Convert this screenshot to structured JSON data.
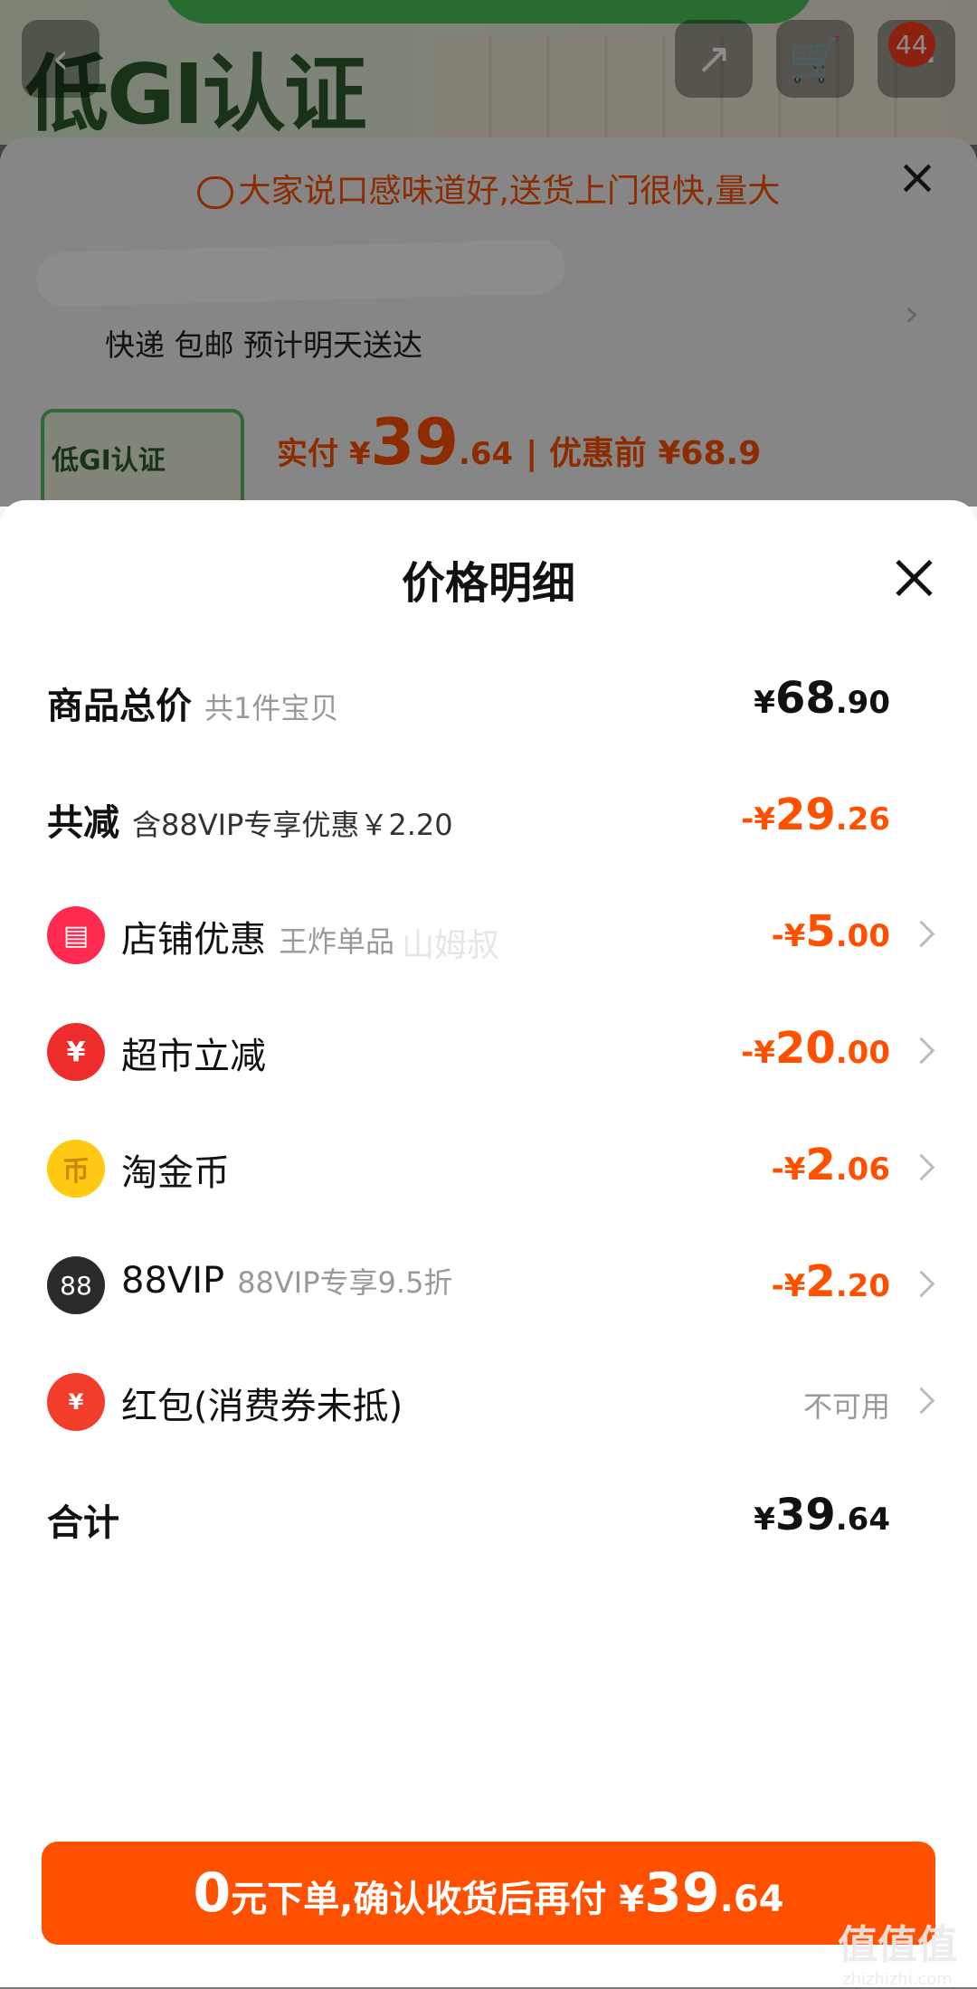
{
  "background": {
    "promo_banner": "低GI认证",
    "cart_count": "44",
    "review_text": "大家说口感味道好,送货上门很快,量大",
    "shipping_text": "快递 包邮 预计明天送达",
    "thumb_text": "低GI认证",
    "price_label": "实付 ¥",
    "price_int": "39",
    "price_cents": ".64",
    "price_before": "| 优惠前 ¥68.9"
  },
  "panel": {
    "title": "价格明细",
    "rows": [
      {
        "label": "商品总价",
        "sub": "共1件宝贝",
        "yen": "¥",
        "int": "68",
        "cents": ".90"
      },
      {
        "label": "共减",
        "sub": "含88VIP专享优惠￥2.20",
        "yen": "-¥",
        "int": "29",
        "cents": ".26"
      },
      {
        "label": "店铺优惠",
        "sub": "王炸单品",
        "yen": "-¥",
        "int": "5",
        "cents": ".00",
        "icon_char": "▤"
      },
      {
        "label": "超市立减",
        "yen": "-¥",
        "int": "20",
        "cents": ".00",
        "icon_char": "¥"
      },
      {
        "label": "淘金币",
        "yen": "-¥",
        "int": "2",
        "cents": ".06",
        "icon_char": "币"
      },
      {
        "label": "88VIP",
        "sub": "88VIP专享9.5折",
        "yen": "-¥",
        "int": "2",
        "cents": ".20",
        "icon_char": "88"
      },
      {
        "label": "红包(消费券未抵)",
        "right_text": "不可用",
        "icon_char": "¥"
      },
      {
        "label": "合计",
        "yen": "¥",
        "int": "39",
        "cents": ".64"
      }
    ],
    "watermark": "山姆叔"
  },
  "cta": {
    "big": "0",
    "text": "元下单,确认收货后再付 ¥",
    "int": "39",
    "cents": ".64"
  },
  "corner_watermark": {
    "main": "值值值",
    "sub": "zhizhizhi.com"
  },
  "colors": {
    "accent": "#ff5000",
    "store_icon": "#ff2a4f",
    "market_icon": "#ee2c2c",
    "coin_icon": "#ffc914",
    "vip_icon": "#2b2b2b",
    "redpacket_icon": "#f23d2b"
  }
}
